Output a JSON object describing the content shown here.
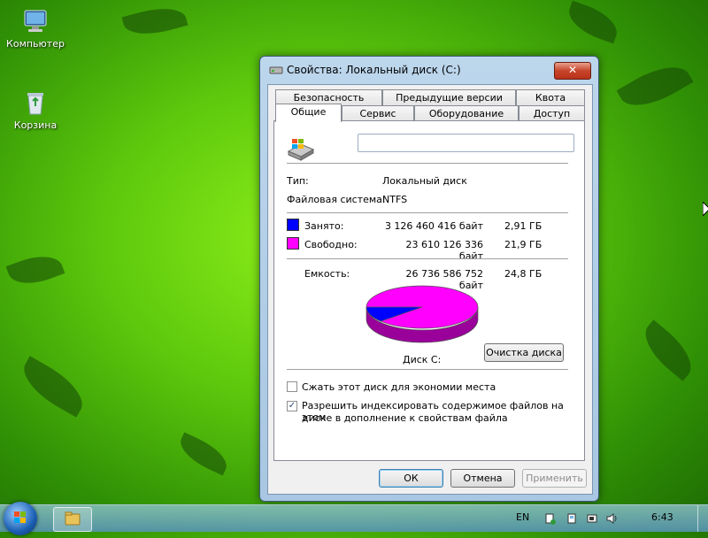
{
  "desktop": {
    "icons": [
      {
        "label": "Компьютер",
        "icon": "computer-icon"
      },
      {
        "label": "Корзина",
        "icon": "recycle-bin-icon"
      }
    ]
  },
  "window": {
    "title": "Свойства: Локальный диск (C:)",
    "close_label": "✕",
    "tabs_row1": [
      "Безопасность",
      "Предыдущие версии",
      "Квота"
    ],
    "tabs_row2": [
      "Общие",
      "Сервис",
      "Оборудование",
      "Доступ"
    ],
    "active_tab": "Общие",
    "general": {
      "name_value": "",
      "type_label": "Тип:",
      "type_value": "Локальный диск",
      "fs_label": "Файловая система:",
      "fs_value": "NTFS",
      "used_label": "Занято:",
      "used_bytes": "3 126 460 416 байт",
      "used_size": "2,91 ГБ",
      "free_label": "Свободно:",
      "free_bytes": "23 610 126 336 байт",
      "free_size": "21,9 ГБ",
      "capacity_label": "Емкость:",
      "capacity_bytes": "26 736 586 752 байт",
      "capacity_size": "24,8 ГБ",
      "used_fraction": 0.117,
      "disk_label": "Диск C:",
      "cleanup_button": "Очистка диска",
      "compress_label": "Сжать этот диск для экономии места",
      "compress_checked": false,
      "index_label_line1": "Разрешить индексировать содержимое файлов на этом",
      "index_label_line2": "диске в дополнение к свойствам файла",
      "index_checked": true
    },
    "buttons": {
      "ok": "ОК",
      "cancel": "Отмена",
      "apply": "Применить"
    }
  },
  "colors": {
    "used": "#0000ff",
    "free": "#ff00ff"
  },
  "taskbar": {
    "language": "EN",
    "time": "6:43"
  }
}
